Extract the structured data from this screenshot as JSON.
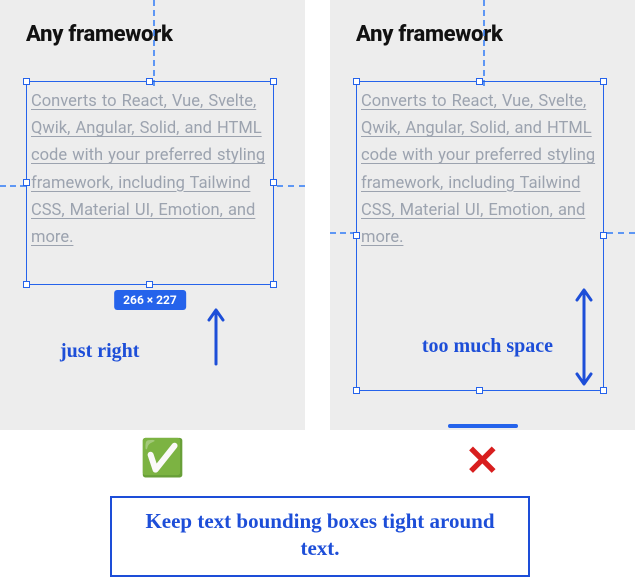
{
  "left": {
    "heading": "Any framework",
    "body": "Converts to React, Vue, Svelte, Qwik, Angular, Solid, and HTML code with your preferred styling framework, including Tailwind CSS, Material UI, Emotion, and more.",
    "dimension_badge": "266 × 227",
    "annotation": "just right"
  },
  "right": {
    "heading": "Any framework",
    "body": "Converts to React, Vue, Svelte, Qwik, Angular, Solid, and HTML code with your preferred styling framework, including Tailwind CSS, Material UI, Emotion, and more.",
    "annotation": "too much space"
  },
  "verdict": {
    "good": "✅",
    "bad": "✕"
  },
  "caption": "Keep text bounding boxes tight around text."
}
